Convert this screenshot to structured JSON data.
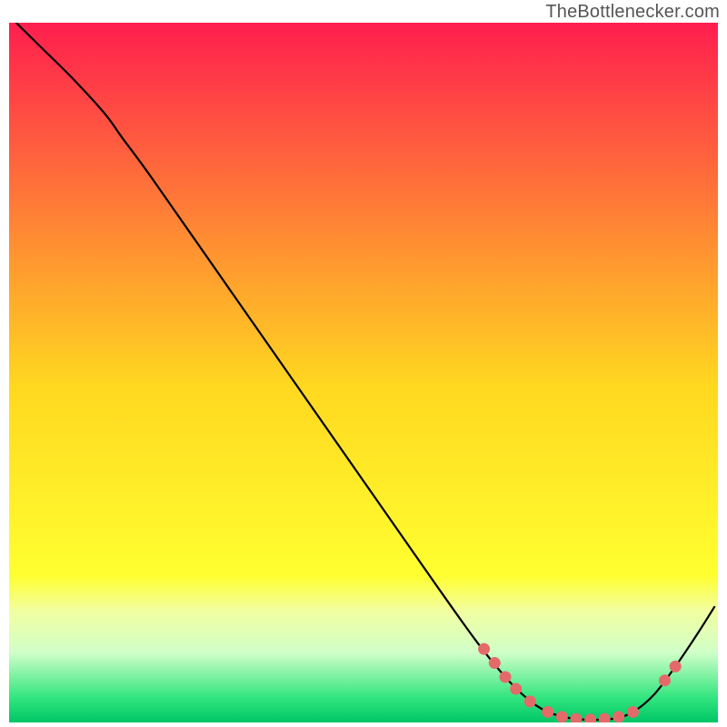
{
  "attribution": "TheBottlenecker.com",
  "chart_data": {
    "type": "line",
    "title": "",
    "xlabel": "",
    "ylabel": "",
    "xlim": [
      0,
      100
    ],
    "ylim": [
      0,
      100
    ],
    "background_gradient": [
      {
        "pos": 0.0,
        "color": "#ff1e4e"
      },
      {
        "pos": 0.52,
        "color": "#ffd820"
      },
      {
        "pos": 0.79,
        "color": "#ffff30"
      },
      {
        "pos": 0.84,
        "color": "#f2ffa0"
      },
      {
        "pos": 0.9,
        "color": "#d0ffc8"
      },
      {
        "pos": 0.965,
        "color": "#31e57e"
      },
      {
        "pos": 1.0,
        "color": "#00c666"
      }
    ],
    "series": [
      {
        "name": "curve",
        "points": [
          {
            "x": 1.0,
            "y": 100.0
          },
          {
            "x": 4.0,
            "y": 97.0
          },
          {
            "x": 9.0,
            "y": 92.0
          },
          {
            "x": 13.5,
            "y": 87.0
          },
          {
            "x": 16.0,
            "y": 83.5
          },
          {
            "x": 20.0,
            "y": 78.0
          },
          {
            "x": 30.0,
            "y": 63.5
          },
          {
            "x": 40.0,
            "y": 49.0
          },
          {
            "x": 50.0,
            "y": 34.5
          },
          {
            "x": 60.0,
            "y": 20.0
          },
          {
            "x": 66.0,
            "y": 11.5
          },
          {
            "x": 70.0,
            "y": 6.5
          },
          {
            "x": 73.0,
            "y": 3.5
          },
          {
            "x": 76.0,
            "y": 1.5
          },
          {
            "x": 80.0,
            "y": 0.5
          },
          {
            "x": 85.0,
            "y": 0.5
          },
          {
            "x": 88.0,
            "y": 1.5
          },
          {
            "x": 91.0,
            "y": 4.0
          },
          {
            "x": 94.0,
            "y": 8.0
          },
          {
            "x": 97.0,
            "y": 12.5
          },
          {
            "x": 99.5,
            "y": 16.5
          }
        ]
      }
    ],
    "markers": [
      {
        "x": 67.0,
        "y": 10.5
      },
      {
        "x": 68.5,
        "y": 8.5
      },
      {
        "x": 70.0,
        "y": 6.5
      },
      {
        "x": 71.5,
        "y": 4.8
      },
      {
        "x": 73.5,
        "y": 3.0
      },
      {
        "x": 76.0,
        "y": 1.5
      },
      {
        "x": 78.0,
        "y": 0.8
      },
      {
        "x": 80.0,
        "y": 0.5
      },
      {
        "x": 82.0,
        "y": 0.4
      },
      {
        "x": 84.0,
        "y": 0.5
      },
      {
        "x": 86.0,
        "y": 0.8
      },
      {
        "x": 88.0,
        "y": 1.5
      },
      {
        "x": 92.5,
        "y": 6.0
      },
      {
        "x": 94.0,
        "y": 8.0
      }
    ],
    "marker_color": "#e46a6a",
    "line_color": "#000000"
  }
}
